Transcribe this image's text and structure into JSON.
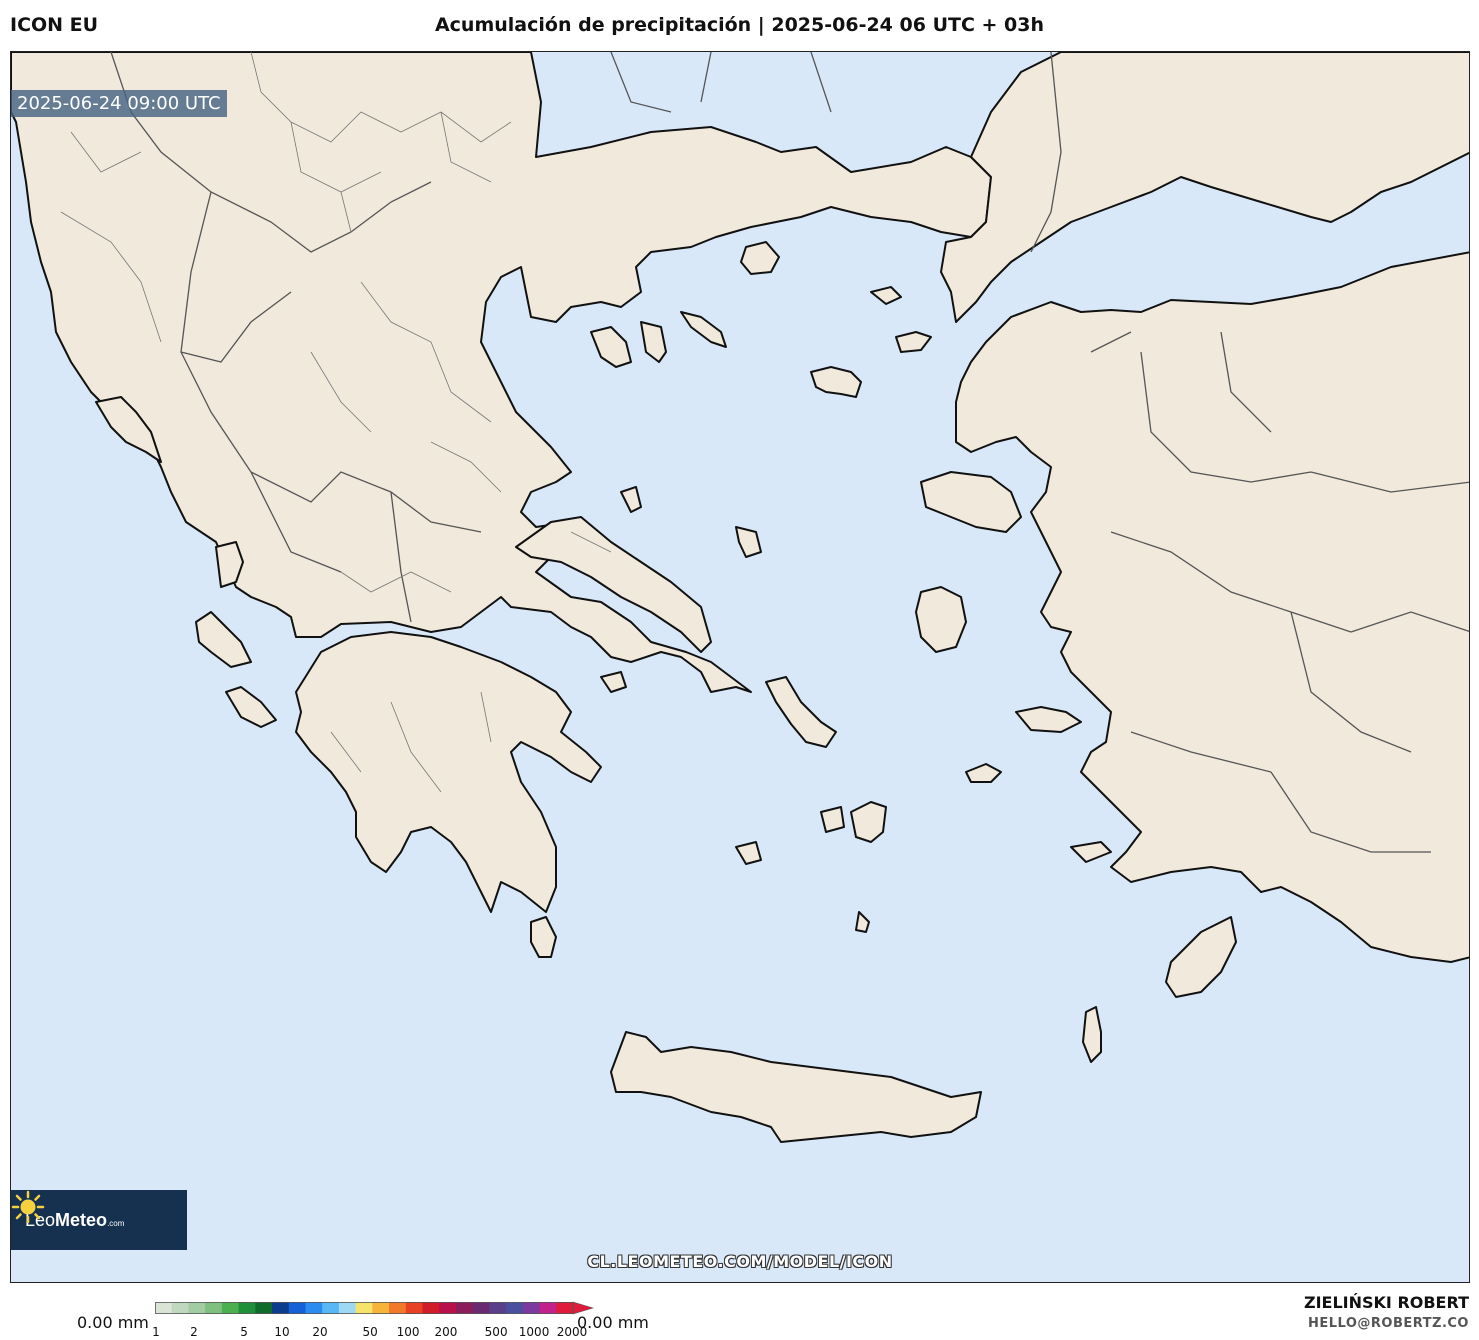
{
  "header": {
    "model": "ICON EU",
    "title": "Acumulación de precipitación | 2025-06-24 06 UTC + 03h"
  },
  "map": {
    "valid_time": "2025-06-24 09:00 UTC",
    "source_url": "CL.LEOMETEO.COM/MODEL/ICON",
    "sea_color": "#d8e8f8",
    "land_color": "#f0e9dc"
  },
  "logo": {
    "name_light": "Leo",
    "name_bold": "Meteo",
    "suffix": ".com",
    "icon": "sun-icon"
  },
  "legend": {
    "min_label": "0.00 mm",
    "max_label": "0.00 mm",
    "ticks": [
      "1",
      "2",
      "5",
      "10",
      "20",
      "50",
      "100",
      "200",
      "500",
      "1000",
      "2000"
    ],
    "colors": [
      "#d9e4d6",
      "#c0d8c0",
      "#a3cca3",
      "#7fbf7f",
      "#4caf50",
      "#1f8f3a",
      "#0f6b2a",
      "#0b3d8c",
      "#1560d6",
      "#2a8cf0",
      "#58b8f5",
      "#9fd8f5",
      "#f5e36a",
      "#f7b43a",
      "#f2782a",
      "#e84022",
      "#d11d2a",
      "#b8104a",
      "#8a1d5a",
      "#6a2a70",
      "#5a3f8a",
      "#4a4f9e",
      "#7a3aa0",
      "#c2208a",
      "#e01a3a"
    ]
  },
  "footer": {
    "author": "ZIELIŃSKI ROBERT",
    "email": "HELLO@ROBERTZ.CO"
  }
}
